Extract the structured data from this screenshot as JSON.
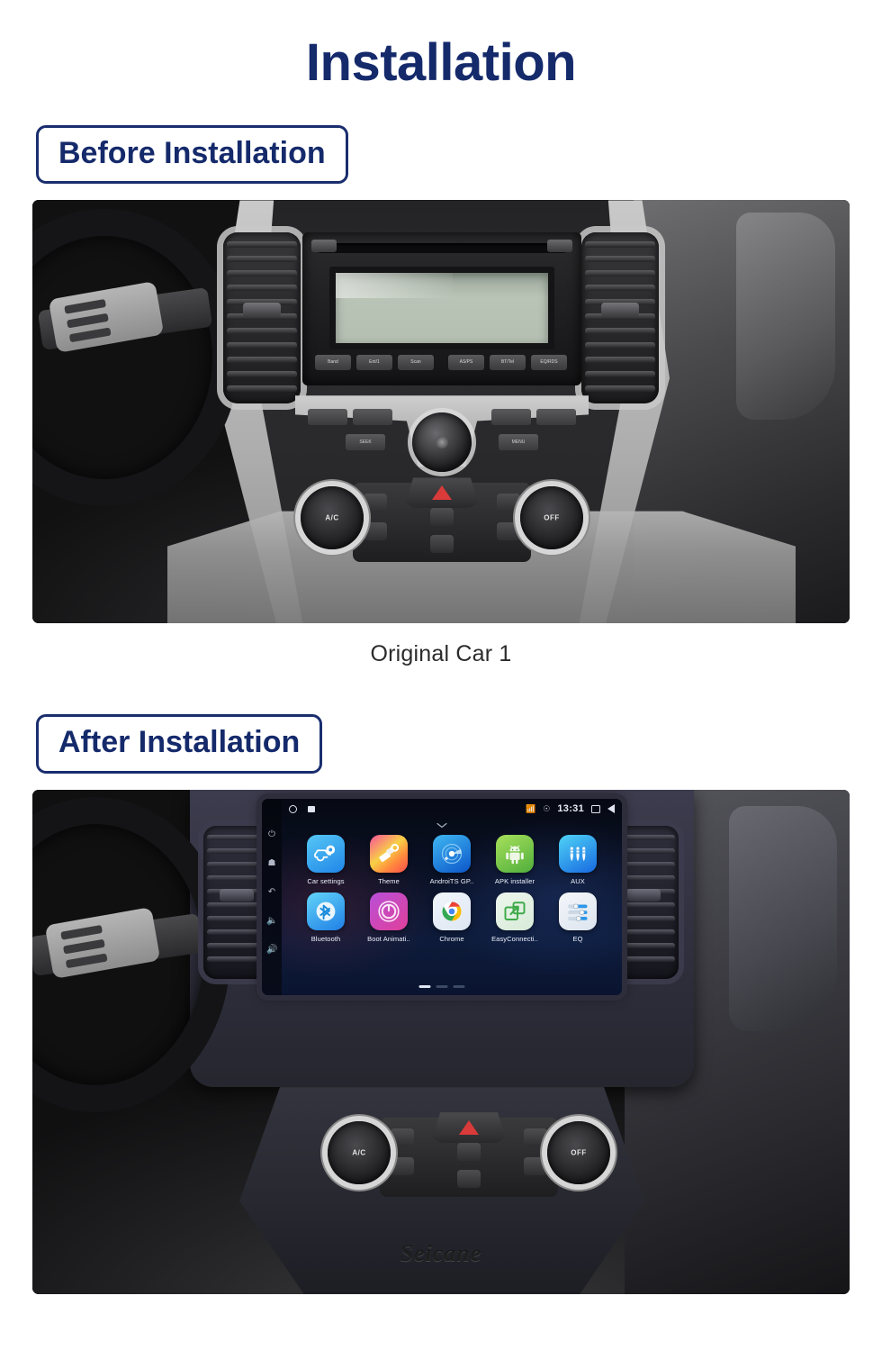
{
  "header": {
    "title": "Installation"
  },
  "sections": [
    {
      "label": "Before Installation",
      "caption": "Original Car  1",
      "photo_name": "original-car-dashboard-photo"
    },
    {
      "label": "After Installation",
      "caption": "",
      "photo_name": "installed-android-head-unit-photo"
    }
  ],
  "head_unit": {
    "statusbar": {
      "home_icon": "circle-home-icon",
      "sd_icon": "sd-card-icon",
      "bluetooth_icon": "bluetooth-icon",
      "location_icon": "location-icon",
      "clock": "13:31",
      "recents_icon": "recents-icon",
      "back_icon": "back-triangle-icon"
    },
    "sidebar_icons": [
      "power-icon",
      "home-icon",
      "back-icon",
      "volume-down-icon",
      "volume-up-icon"
    ],
    "expand_icon": "chevron-down-icon",
    "apps": [
      {
        "label": "Car settings",
        "icon": "car-settings-icon",
        "glyph": "⚙"
      },
      {
        "label": "Theme",
        "icon": "paintbrush-icon",
        "glyph": "✎"
      },
      {
        "label": "AndroiTS GP..",
        "icon": "gps-radar-icon",
        "glyph": "◎"
      },
      {
        "label": "APK installer",
        "icon": "android-robot-icon",
        "glyph": "⚙"
      },
      {
        "label": "AUX",
        "icon": "aux-jack-icon",
        "glyph": "‖"
      },
      {
        "label": "Bluetooth",
        "icon": "bluetooth-icon",
        "glyph": "ᛗ"
      },
      {
        "label": "Boot Animati..",
        "icon": "power-ring-icon",
        "glyph": "⏻"
      },
      {
        "label": "Chrome",
        "icon": "chrome-icon",
        "glyph": "●"
      },
      {
        "label": "EasyConnecti..",
        "icon": "screen-mirror-icon",
        "glyph": "↗"
      },
      {
        "label": "EQ",
        "icon": "equalizer-icon",
        "glyph": "≡"
      }
    ],
    "page_indicator": {
      "count": 3,
      "active": 1
    },
    "watermark": "Seicane"
  },
  "original_radio": {
    "preset_buttons": [
      "Band",
      "Ent/1",
      "Scan",
      "AS/PS",
      "BT/Tel",
      "EQ/RDS"
    ],
    "lower_buttons": [
      "SEEK",
      "MENU"
    ]
  },
  "climate": {
    "left_knob": "A/C",
    "right_knob": "OFF",
    "hazard_icon": "hazard-triangle-icon"
  },
  "colors": {
    "brand_navy": "#152a6b",
    "border_navy": "#1a2e6e",
    "caption_text": "#2b2b2b",
    "page_bg": "#ffffff"
  }
}
